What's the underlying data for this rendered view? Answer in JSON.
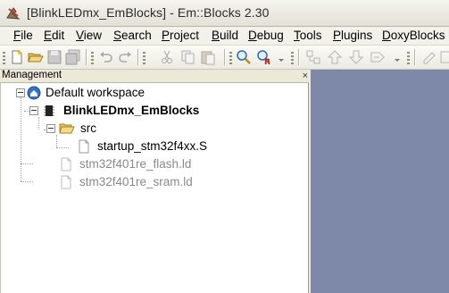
{
  "window": {
    "title": "[BlinkLEDmx_EmBlocks] - Em::Blocks 2.30"
  },
  "menu": [
    {
      "label": "File",
      "ul": "F",
      "rest": "ile"
    },
    {
      "label": "Edit",
      "ul": "E",
      "rest": "dit"
    },
    {
      "label": "View",
      "ul": "V",
      "rest": "iew"
    },
    {
      "label": "Search",
      "ul": "S",
      "rest": "earch"
    },
    {
      "label": "Project",
      "ul": "P",
      "rest": "roject"
    },
    {
      "label": "Build",
      "ul": "B",
      "rest": "uild"
    },
    {
      "label": "Debug",
      "ul": "D",
      "rest": "ebug"
    },
    {
      "label": "Tools",
      "ul": "T",
      "rest": "ools"
    },
    {
      "label": "Plugins",
      "ul": "P",
      "rest": "lugins"
    },
    {
      "label": "DoxyBlocks",
      "ul": "D",
      "rest": "oxyBlocks"
    }
  ],
  "toolbar": {
    "icons": [
      "new-file-icon",
      "open-folder-icon",
      "save-icon",
      "save-all-icon",
      "undo-icon",
      "redo-icon",
      "cut-icon",
      "copy-icon",
      "paste-icon",
      "find-icon",
      "replace-icon",
      "jump-icon",
      "bookmark-prev-icon",
      "bookmark-next-icon",
      "bookmark-toggle-icon"
    ]
  },
  "management": {
    "label": "Management",
    "close": "×"
  },
  "tree": {
    "workspace": "Default workspace",
    "project": "BlinkLEDmx_EmBlocks",
    "folder": "src",
    "source_file": "startup_stm32f4xx.S",
    "linker_files": [
      "stm32f401re_flash.ld",
      "stm32f401re_sram.ld"
    ]
  },
  "colors": {
    "editor_bg": "#7e88a8",
    "greyed_text": "#8a8a8a"
  }
}
